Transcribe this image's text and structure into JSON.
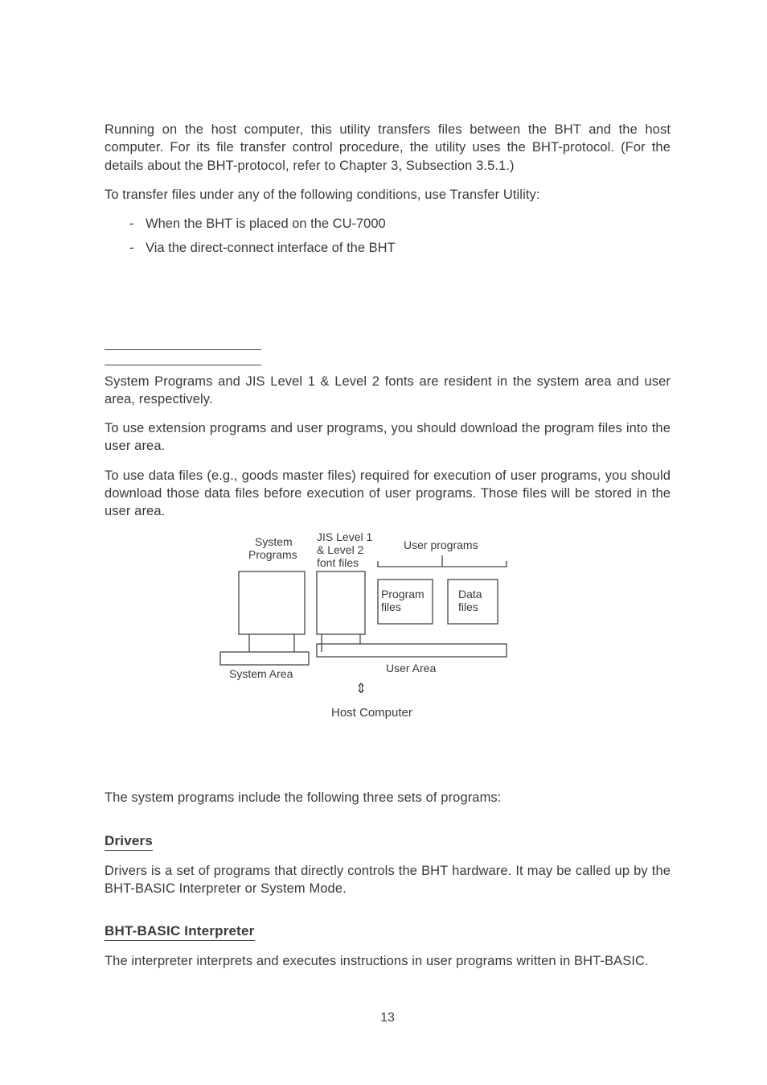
{
  "para1": "Running on the host computer, this utility transfers files between the BHT and the host computer.  For its file transfer control procedure, the utility uses the BHT-protocol. (For the details about the BHT-protocol, refer to Chapter 3, Subsection 3.5.1.)",
  "para2": "To transfer files under any of the following conditions, use Transfer Utility:",
  "list1": "When the BHT is placed on the CU-7000",
  "list2": "Via the direct-connect interface of the BHT",
  "para3": "System Programs and JIS Level 1 & Level 2 fonts are resident in the system area and user area, respectively.",
  "para4": "To use extension programs and user programs, you should download the program files into the user area.",
  "para5": "To use data files (e.g., goods master files) required for execution of user programs, you should download those data files before execution of user programs. Those files will be stored in the user area.",
  "diagram": {
    "system_programs": "System\nPrograms",
    "jis": "JIS Level 1\n& Level 2\nfont files",
    "user_programs": "User programs",
    "program_files": "Program\nfiles",
    "data_files": "Data\nfiles",
    "system_area": "System Area",
    "user_area": "User Area",
    "host": "Host Computer"
  },
  "para6": "The system programs include the following three sets of programs:",
  "h_drivers": "Drivers",
  "para7": "Drivers is a set of programs that directly controls the BHT hardware.  It may be called up by the BHT-BASIC Interpreter or System Mode.",
  "h_interp": "BHT-BASIC Interpreter",
  "para8": "The interpreter interprets and executes instructions in user programs written in BHT-BASIC.",
  "pagenum": "13"
}
